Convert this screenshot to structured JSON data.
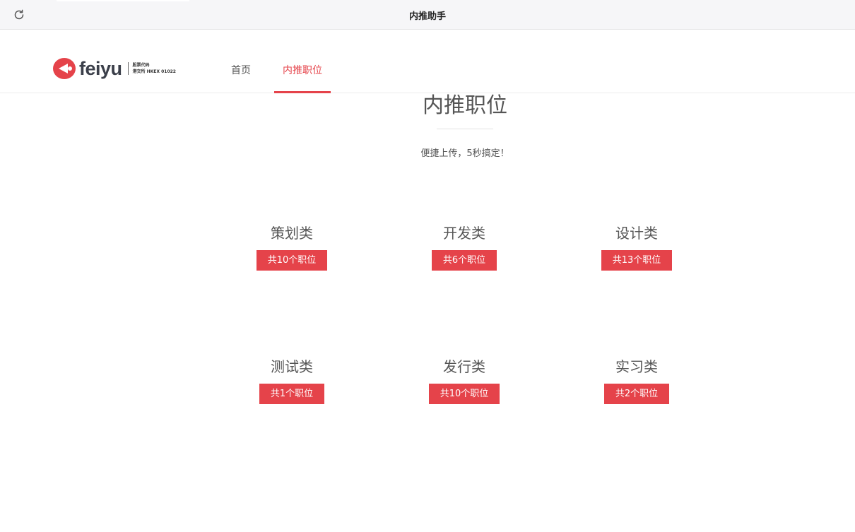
{
  "app": {
    "title": "内推助手",
    "refresh_icon": "refresh-icon"
  },
  "header": {
    "logo": {
      "word": "feiyu",
      "stock_line1": "股票代码",
      "stock_line2": "港交所 HKEX 01022"
    },
    "nav": [
      {
        "label": "首页",
        "active": false
      },
      {
        "label": "内推职位",
        "active": true
      }
    ],
    "accent_color": "#e5434a"
  },
  "hero": {
    "title": "内推职位",
    "subtitle": "便捷上传，5秒搞定！"
  },
  "categories": [
    {
      "name": "策划类",
      "count": "共10个职位"
    },
    {
      "name": "开发类",
      "count": "共6个职位"
    },
    {
      "name": "设计类",
      "count": "共13个职位"
    },
    {
      "name": "测试类",
      "count": "共1个职位"
    },
    {
      "name": "发行类",
      "count": "共10个职位"
    },
    {
      "name": "实习类",
      "count": "共2个职位"
    }
  ]
}
